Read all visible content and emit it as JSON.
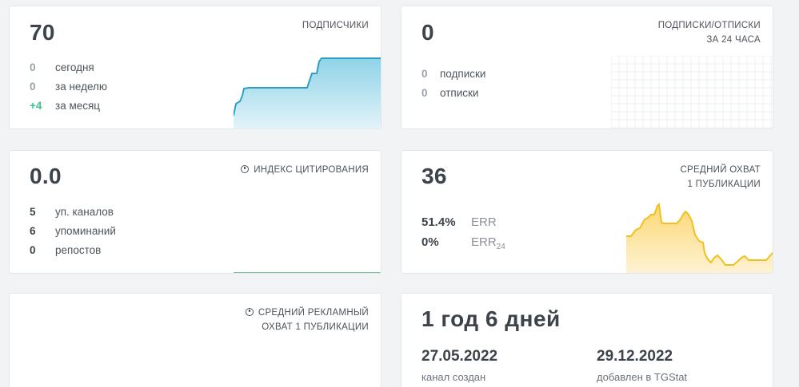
{
  "subscribers": {
    "value": "70",
    "title": "ПОДПИСЧИКИ",
    "rows": [
      {
        "num": "0",
        "label": "сегодня"
      },
      {
        "num": "0",
        "label": "за неделю"
      },
      {
        "num": "+4",
        "label": "за месяц"
      }
    ],
    "accent_color": "#3aa9c9"
  },
  "subs_unsubs": {
    "value": "0",
    "title_line1": "ПОДПИСКИ/ОТПИСКИ",
    "title_line2": "ЗА 24 ЧАСА",
    "rows": [
      {
        "num": "0",
        "label": "подписки"
      },
      {
        "num": "0",
        "label": "отписки"
      }
    ]
  },
  "citation": {
    "value": "0.0",
    "title": "ИНДЕКС ЦИТИРОВАНИЯ",
    "rows": [
      {
        "num": "5",
        "label": "уп. каналов"
      },
      {
        "num": "6",
        "label": "упоминаний"
      },
      {
        "num": "0",
        "label": "репостов"
      }
    ],
    "accent_color": "#3fb577"
  },
  "avg_reach": {
    "value": "36",
    "title_line1": "СРЕДНИЙ ОХВАТ",
    "title_line2": "1 ПУБЛИКАЦИИ",
    "err": {
      "num": "51.4%",
      "label": "ERR"
    },
    "err24": {
      "num": "0%",
      "label": "ERR",
      "sub": "24"
    },
    "accent_color": "#f2c01e"
  },
  "ad_reach": {
    "title_line1": "СРЕДНИЙ РЕКЛАМНЫЙ",
    "title_line2": "ОХВАТ 1 ПУБЛИКАЦИИ"
  },
  "age": {
    "value": "1 год 6 дней",
    "created": {
      "date": "27.05.2022",
      "label": "канал создан"
    },
    "added": {
      "date": "29.12.2022",
      "label": "добавлен в TGStat"
    }
  }
}
